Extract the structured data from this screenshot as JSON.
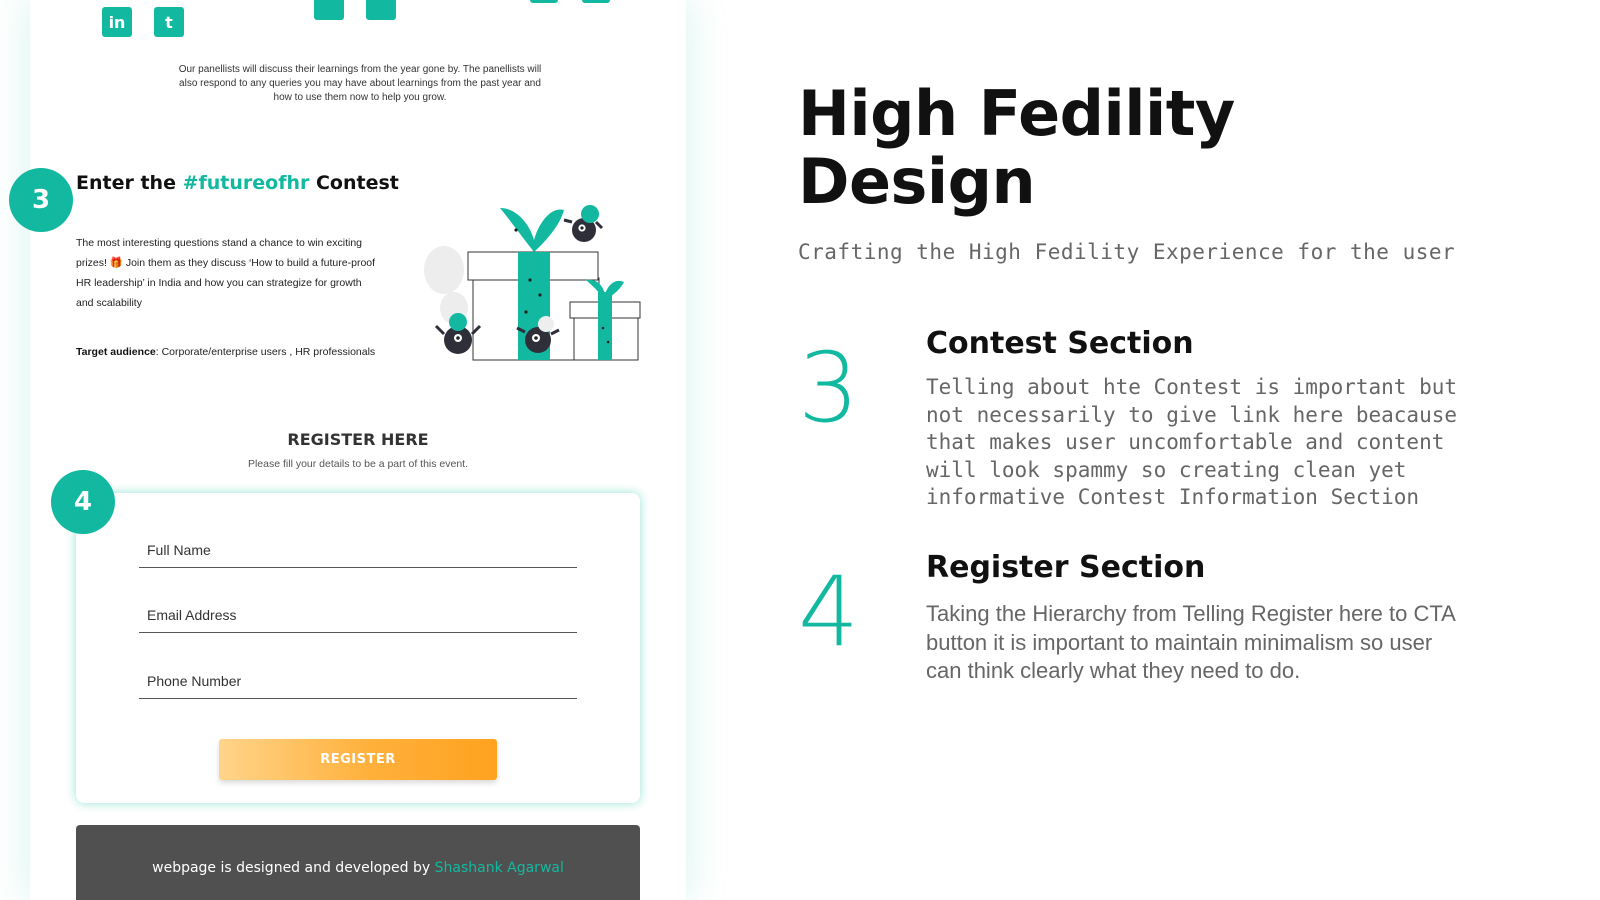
{
  "mock": {
    "social_glyphs": {
      "linkedin": "in",
      "twitter": "t"
    },
    "panel_description": "Our panellists will discuss their learnings from the year gone by. The panellists will also respond to any queries you may have about learnings from the past year and how to use them now to help you grow.",
    "contest": {
      "title_prefix": "Enter the ",
      "title_hashtag": "#futureofhr",
      "title_suffix": " Contest",
      "body": "The most interesting questions stand a chance to win exciting prizes! 🎁 Join them as they discuss ‘How to build a future-proof HR leadership’ in India and how you can strategize for growth and scalability",
      "target_label": "Target audience",
      "target_value": ": Corporate/enterprise users , HR professionals"
    },
    "register": {
      "title": "REGISTER HERE",
      "subtitle": "Please fill your details to be a part of this event.",
      "fields": {
        "full_name": "Full Name",
        "email": "Email Address",
        "phone": "Phone Number"
      },
      "button": "REGISTER"
    },
    "footer": {
      "text": "webpage is designed and developed by ",
      "author": "Shashank Agarwal"
    },
    "badges": {
      "contest": "3",
      "register": "4"
    }
  },
  "doc": {
    "title": "High Fedility Design",
    "subtitle": "Crafting the High Fedility Experience for the user",
    "sections": [
      {
        "number": "3",
        "title": "Contest Section",
        "body": "Telling about hte Contest is important but not necessarily to give link here beacause that makes user uncomfortable and content will look spammy so creating clean yet informative Contest Information Section"
      },
      {
        "number": "4",
        "title": "Register Section",
        "body": "Taking the Hierarchy from Telling Register here to CTA button it is important to maintain minimalism so user can think clearly what they need to do."
      }
    ]
  },
  "colors": {
    "accent": "#12b9a0",
    "cta": "#ffa21f",
    "footer_bg": "#505050"
  }
}
